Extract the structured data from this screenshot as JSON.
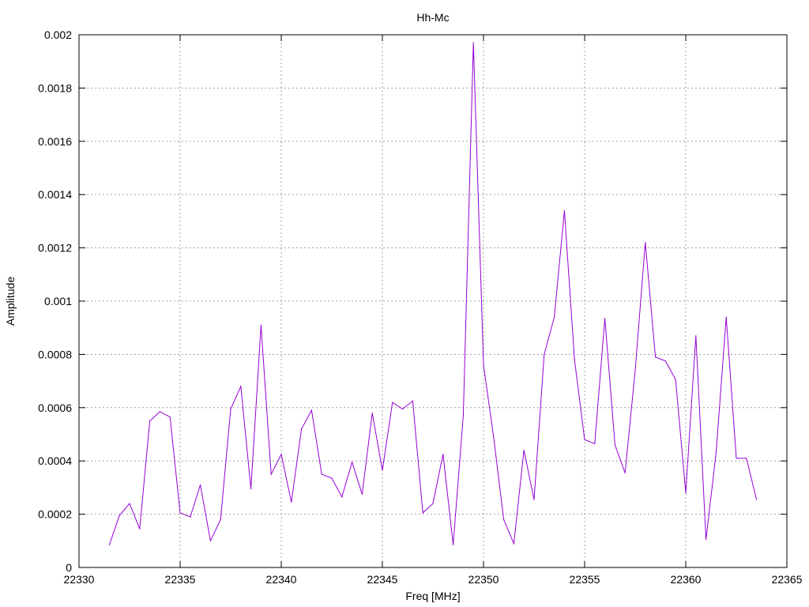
{
  "chart_data": {
    "type": "line",
    "title": "Hh-Mc",
    "xlabel": "Freq [MHz]",
    "ylabel": "Amplitude",
    "xlim": [
      22330,
      22365
    ],
    "ylim": [
      0,
      0.002
    ],
    "x_ticks": [
      "22330",
      "22335",
      "22340",
      "22345",
      "22350",
      "22355",
      "22360",
      "22365"
    ],
    "y_ticks": [
      "0",
      "0.0002",
      "0.0004",
      "0.0006",
      "0.0008",
      "0.001",
      "0.0012",
      "0.0014",
      "0.0016",
      "0.0018",
      "0.002"
    ],
    "grid": true,
    "legend": "none",
    "series": [
      {
        "color": "#9400d3",
        "x": [
          22331.5,
          22332.0,
          22332.5,
          22333.0,
          22333.5,
          22334.0,
          22334.5,
          22335.0,
          22335.5,
          22336.0,
          22336.5,
          22337.0,
          22337.5,
          22338.0,
          22338.5,
          22339.0,
          22339.5,
          22340.0,
          22340.5,
          22341.0,
          22341.5,
          22342.0,
          22342.5,
          22343.0,
          22343.5,
          22344.0,
          22344.5,
          22345.0,
          22345.5,
          22346.0,
          22346.5,
          22347.0,
          22347.5,
          22348.0,
          22348.5,
          22349.0,
          22349.5,
          22350.0,
          22350.5,
          22351.0,
          22351.5,
          22352.0,
          22352.5,
          22353.0,
          22353.5,
          22354.0,
          22354.5,
          22355.0,
          22355.5,
          22356.0,
          22356.5,
          22357.0,
          22357.5,
          22358.0,
          22358.5,
          22359.0,
          22359.5,
          22360.0,
          22360.5,
          22361.0,
          22361.5,
          22362.0,
          22362.5,
          22363.0,
          22363.5
        ],
        "y": [
          8.5e-05,
          0.000195,
          0.00024,
          0.000145,
          0.00055,
          0.000585,
          0.000565,
          0.000205,
          0.00019,
          0.00031,
          0.0001,
          0.00018,
          0.000595,
          0.00068,
          0.000295,
          0.00091,
          0.00035,
          0.000425,
          0.000245,
          0.00052,
          0.00059,
          0.00035,
          0.000335,
          0.000265,
          0.000395,
          0.000275,
          0.00058,
          0.000365,
          0.00062,
          0.000595,
          0.000625,
          0.000205,
          0.00024,
          0.000425,
          8.5e-05,
          0.00057,
          0.00197,
          0.00076,
          0.00049,
          0.00018,
          9e-05,
          0.00044,
          0.000255,
          0.0008,
          0.00094,
          0.00134,
          0.00078,
          0.00048,
          0.000465,
          0.000935,
          0.00046,
          0.000355,
          0.00074,
          0.00122,
          0.00079,
          0.000775,
          0.000705,
          0.00028,
          0.00087,
          0.000105,
          0.00043,
          0.00094,
          0.00041,
          0.00041,
          0.000255
        ]
      }
    ]
  }
}
